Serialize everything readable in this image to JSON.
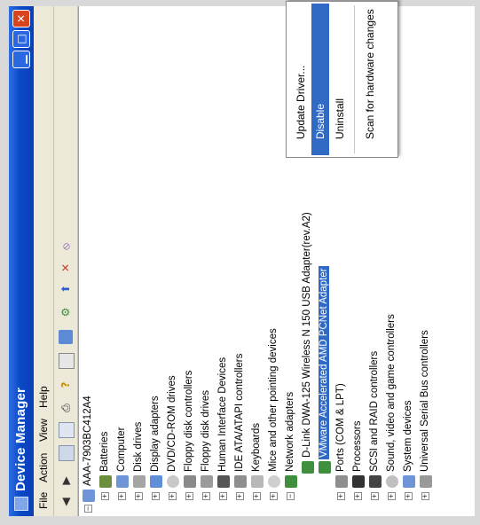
{
  "window": {
    "title": "Device Manager"
  },
  "menu": [
    "File",
    "Action",
    "View",
    "Help"
  ],
  "toolbar": {
    "buttons": [
      "back-arrow-icon",
      "forward-arrow-icon",
      "properties-icon",
      "console-tree-icon",
      "print-icon",
      "help-icon",
      "console-icon",
      "refresh-icon",
      "scan-hardware-icon",
      "update-driver-icon",
      "uninstall-icon",
      "disable-icon"
    ]
  },
  "tree": {
    "root": "AAA-7903BC412A4",
    "items": [
      "Batteries",
      "Computer",
      "Disk drives",
      "Display adapters",
      "DVD/CD-ROM drives",
      "Floppy disk controllers",
      "Floppy disk drives",
      "Human Interface Devices",
      "IDE ATA/ATAPI controllers",
      "Keyboards",
      "Mice and other pointing devices",
      "Network adapters",
      "D-Link DWA-125 Wireless N 150 USB Adapter(rev.A2)",
      "VMware Accelerated AMD PCNet Adapter",
      "Ports (COM & LPT)",
      "Processors",
      "SCSI and RAID controllers",
      "Sound, video and game controllers",
      "System devices",
      "Universal Serial Bus controllers"
    ]
  },
  "context_menu": {
    "items": [
      "Update Driver...",
      "Disable",
      "Uninstall",
      "Scan for hardware changes"
    ]
  }
}
